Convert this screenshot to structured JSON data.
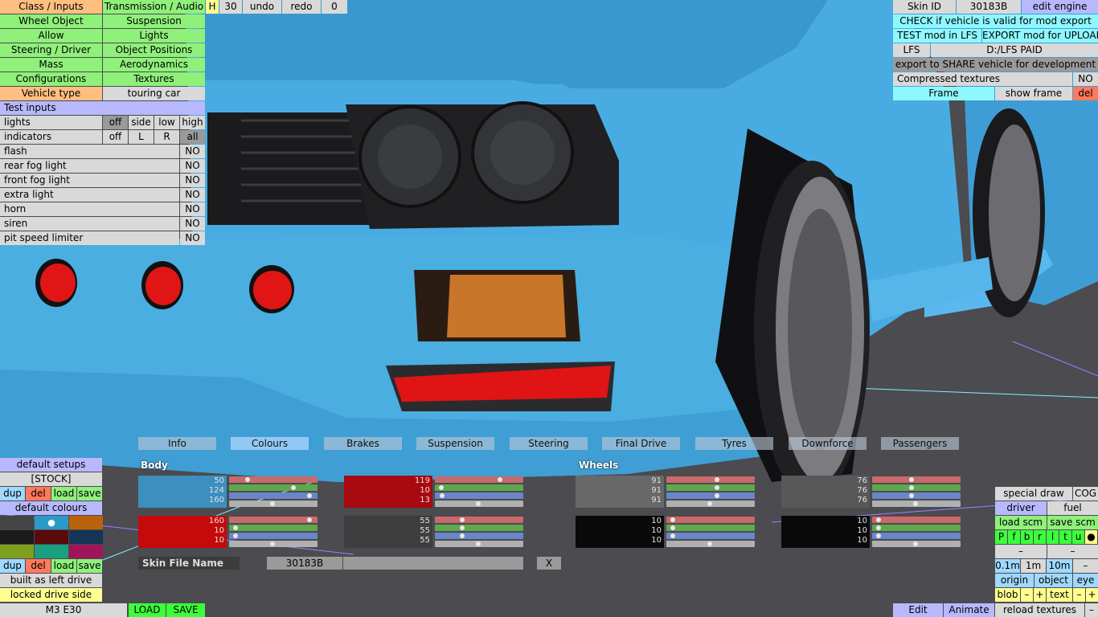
{
  "top_left_menu": {
    "row1": [
      "Class / Inputs",
      "Transmission / Audio"
    ],
    "row2": [
      "Wheel Object",
      "Suspension"
    ],
    "row3": [
      "Allow",
      "Lights"
    ],
    "row4": [
      "Steering / Driver",
      "Object Positions"
    ],
    "row5": [
      "Mass",
      "Aerodynamics"
    ],
    "row6": [
      "Configurations",
      "Textures"
    ],
    "vehicle_type_label": "Vehicle type",
    "vehicle_type_value": "touring car",
    "test_inputs": "Test inputs"
  },
  "top_toolbar": {
    "h": "H",
    "num": "30",
    "undo": "undo",
    "redo": "redo",
    "zero": "0"
  },
  "inputs": {
    "lights": {
      "label": "lights",
      "options": [
        "off",
        "side",
        "low",
        "high"
      ]
    },
    "indicators": {
      "label": "indicators",
      "options": [
        "off",
        "L",
        "R",
        "all"
      ]
    },
    "rows": [
      {
        "label": "flash",
        "value": "NO"
      },
      {
        "label": "rear fog light",
        "value": "NO"
      },
      {
        "label": "front fog light",
        "value": "NO"
      },
      {
        "label": "extra light",
        "value": "NO"
      },
      {
        "label": "horn",
        "value": "NO"
      },
      {
        "label": "siren",
        "value": "NO"
      },
      {
        "label": "pit speed limiter",
        "value": "NO"
      }
    ]
  },
  "top_right": {
    "skin_id_label": "Skin ID",
    "skin_id_value": "30183B",
    "edit_engine": "edit engine",
    "check": "CHECK if vehicle is valid for mod export",
    "test_mod": "TEST mod in LFS",
    "export_mod": "EXPORT mod for UPLOAD",
    "lfs": "LFS",
    "lfs_path": "D:/LFS PAID",
    "export_share": "export to SHARE vehicle for development",
    "compressed_label": "Compressed textures",
    "compressed_value": "NO",
    "frame": "Frame",
    "show_frame": "show frame",
    "del": "del"
  },
  "tabs": [
    "Info",
    "Colours",
    "Brakes",
    "Suspension",
    "Steering",
    "Final Drive",
    "Tyres",
    "Downforce",
    "Passengers"
  ],
  "colours": {
    "body_label": "Body",
    "wheels_label": "Wheels",
    "blocks": [
      {
        "rgb": [
          "50",
          "124",
          "160"
        ],
        "color": "#3c8fbf"
      },
      {
        "rgb": [
          "119",
          "10",
          "13"
        ],
        "color": "#a80a10"
      },
      {
        "rgb": [
          "91",
          "91",
          "91"
        ],
        "color": "#686868"
      },
      {
        "rgb": [
          "76",
          "76",
          "76"
        ],
        "color": "#585858"
      },
      {
        "rgb": [
          "160",
          "10",
          "10"
        ],
        "color": "#c40a0a"
      },
      {
        "rgb": [
          "55",
          "55",
          "55"
        ],
        "color": "#3e3e3e"
      },
      {
        "rgb": [
          "10",
          "10",
          "10"
        ],
        "color": "#0a0a0a"
      },
      {
        "rgb": [
          "10",
          "10",
          "10"
        ],
        "color": "#0a0a0a"
      }
    ],
    "slider_levels": [
      [
        0.2,
        0.75,
        0.95,
        0.5
      ],
      [
        0.76,
        0.05,
        0.06,
        0.5
      ],
      [
        0.59,
        0.59,
        0.59,
        0.5
      ],
      [
        0.45,
        0.45,
        0.45,
        0.5
      ],
      [
        0.95,
        0.05,
        0.05,
        0.5
      ],
      [
        0.3,
        0.3,
        0.3,
        0.5
      ],
      [
        0.05,
        0.05,
        0.05,
        0.5
      ],
      [
        0.05,
        0.05,
        0.05,
        0.5
      ]
    ]
  },
  "skin_file": {
    "label": "Skin File Name",
    "value": "30183B",
    "clear": "X"
  },
  "left_bottom": {
    "default_setups": "default setups",
    "stock": "[STOCK]",
    "dup": "dup",
    "del": "del",
    "load": "load",
    "save": "save",
    "default_colours": "default colours",
    "palette": [
      "#444444",
      "#2a9bc8",
      "#b8620a",
      "#1a1a1a",
      "#5a0a0a",
      "#143654",
      "#7fa01c",
      "#18a080",
      "#a0145a"
    ],
    "palette_selected": "●",
    "built_left": "built as left drive",
    "locked_drive": "locked drive side",
    "car_name": "M3 E30",
    "load_btn": "LOAD",
    "save_btn": "SAVE"
  },
  "bottom_right": {
    "special_draw": "special draw",
    "cog": "COG",
    "driver": "driver",
    "fuel": "fuel",
    "load_scm": "load scm",
    "save_scm": "save scm",
    "letters": [
      "P",
      "f",
      "b",
      "r",
      "l",
      "t",
      "u",
      "●"
    ],
    "minus": "–",
    "d1": "0.1m",
    "d2": "1m",
    "d3": "10m",
    "origin": "origin",
    "object": "object",
    "eye": "eye",
    "blob": "blob",
    "plus": "+",
    "text": "text",
    "edit": "Edit",
    "animate": "Animate",
    "reload": "reload textures",
    "dash": "–"
  },
  "scene_colors": {
    "car_body": "#4aaee0",
    "background": "#4a4a4e",
    "accent_red": "#d01010"
  }
}
